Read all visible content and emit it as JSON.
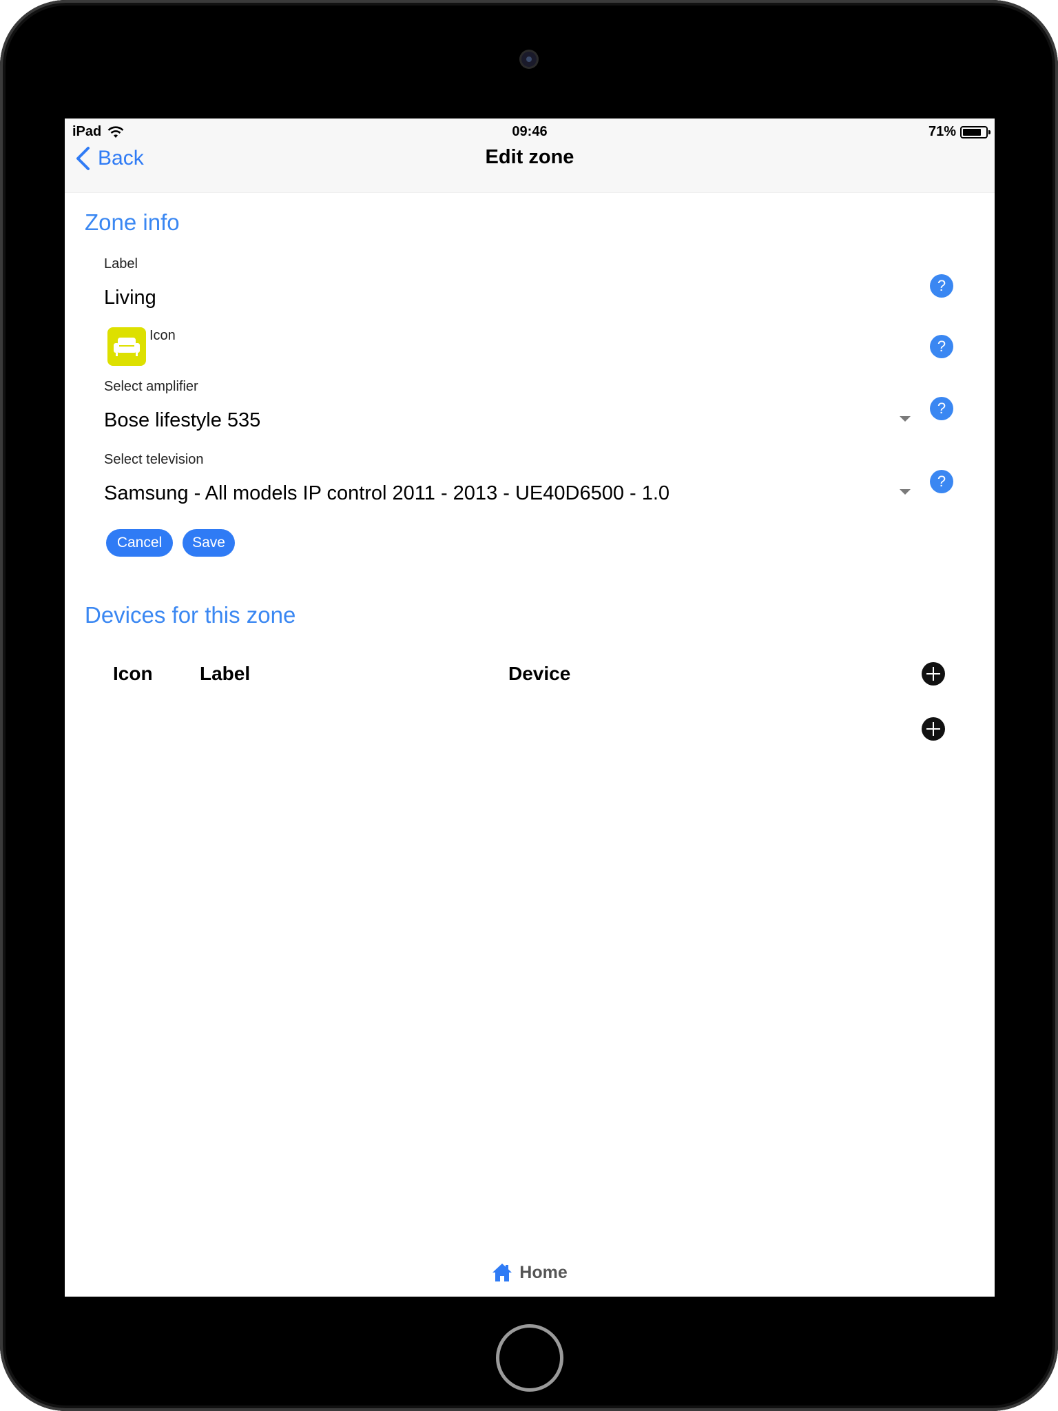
{
  "status_bar": {
    "device": "iPad",
    "time": "09:46",
    "battery": "71%",
    "battery_level": 0.71
  },
  "nav": {
    "back_label": "Back",
    "title": "Edit zone"
  },
  "zone_info": {
    "section_title": "Zone info",
    "label_caption": "Label",
    "label_value": "Living",
    "icon_caption": "Icon",
    "icon_name": "sofa-icon",
    "icon_color": "#dde000",
    "amplifier_caption": "Select amplifier",
    "amplifier_value": "Bose lifestyle 535",
    "television_caption": "Select television",
    "television_value": "Samsung - All models IP control 2011 - 2013 - UE40D6500 - 1.0",
    "cancel_label": "Cancel",
    "save_label": "Save"
  },
  "devices": {
    "section_title": "Devices for this zone",
    "columns": [
      "Icon",
      "Label",
      "Device"
    ],
    "rows": []
  },
  "tab_bar": {
    "home_label": "Home"
  },
  "colors": {
    "accent": "#2f7bf5",
    "section_title": "#3a87f2",
    "nav_background": "#f7f7f7"
  }
}
